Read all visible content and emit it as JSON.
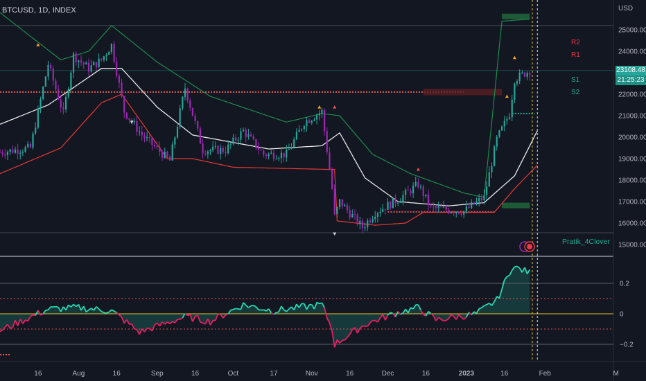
{
  "header": {
    "symbol": "BTCUSD, 1D, INDEX"
  },
  "price_axis": {
    "currency": "USD",
    "ticks": [
      25000,
      24000,
      23000,
      22000,
      21000,
      20000,
      19000,
      18000,
      17000,
      16000,
      15000
    ],
    "tick_labels": [
      "25000.00",
      "24000.00",
      "23000.00",
      "22000.00",
      "21000.00",
      "20000.00",
      "19000.00",
      "18000.00",
      "17000.00",
      "16000.00",
      "15000.00"
    ],
    "last_price": "23108.48",
    "countdown": "21:25:23"
  },
  "osc_axis": {
    "ticks": [
      0.2,
      0,
      -0.2
    ],
    "tick_labels": [
      "0.2",
      "0",
      "−0.2"
    ]
  },
  "time_axis": {
    "labels": [
      "16",
      "Aug",
      "16",
      "Sep",
      "16",
      "Oct",
      "17",
      "Nov",
      "16",
      "Dec",
      "16",
      "2023",
      "16",
      "Feb",
      "M"
    ]
  },
  "pivots": {
    "r2": "R2",
    "r1": "R1",
    "s1": "S1",
    "s2": "S2"
  },
  "watermark": "Pratik_4Clover",
  "colors": {
    "background": "#131722",
    "candle_up": "#26a69a",
    "candle_down": "#9c27b0",
    "ma_white": "#e8e8e8",
    "band_upper": "#1f8a4c",
    "band_lower": "#e53935",
    "resistance_dotted": "#ef5350",
    "last_price_box": "#26a69a",
    "osc_up": "#26d9b4",
    "osc_down": "#e91e63",
    "zero_line": "#e6c229",
    "pivot_red": "#f23645",
    "pivot_green": "#22ab94"
  },
  "chart_data": {
    "type": "candlestick",
    "title": "BTCUSD, 1D, INDEX",
    "ylabel": "USD",
    "ylim": [
      14600,
      26100
    ],
    "x_range": [
      "2022-07-01",
      "2023-02-28"
    ],
    "close_anchors": [
      {
        "date": "2022-07-01",
        "close": 19300
      },
      {
        "date": "2022-07-13",
        "close": 19500
      },
      {
        "date": "2022-07-20",
        "close": 23400
      },
      {
        "date": "2022-07-26",
        "close": 21100
      },
      {
        "date": "2022-07-30",
        "close": 23800
      },
      {
        "date": "2022-08-05",
        "close": 23200
      },
      {
        "date": "2022-08-10",
        "close": 23600
      },
      {
        "date": "2022-08-14",
        "close": 24300
      },
      {
        "date": "2022-08-19",
        "close": 21200
      },
      {
        "date": "2022-08-26",
        "close": 20100
      },
      {
        "date": "2022-09-06",
        "close": 18900
      },
      {
        "date": "2022-09-12",
        "close": 22300
      },
      {
        "date": "2022-09-19",
        "close": 19400
      },
      {
        "date": "2022-09-28",
        "close": 19400
      },
      {
        "date": "2022-10-05",
        "close": 20300
      },
      {
        "date": "2022-10-13",
        "close": 19200
      },
      {
        "date": "2022-10-22",
        "close": 19200
      },
      {
        "date": "2022-10-29",
        "close": 20700
      },
      {
        "date": "2022-11-05",
        "close": 21200
      },
      {
        "date": "2022-11-09",
        "close": 17600
      },
      {
        "date": "2022-11-10",
        "close": 16300
      },
      {
        "date": "2022-11-12",
        "close": 17000
      },
      {
        "date": "2022-11-21",
        "close": 15800
      },
      {
        "date": "2022-11-26",
        "close": 16500
      },
      {
        "date": "2022-12-05",
        "close": 17100
      },
      {
        "date": "2022-12-13",
        "close": 17800
      },
      {
        "date": "2022-12-18",
        "close": 16700
      },
      {
        "date": "2022-12-31",
        "close": 16550
      },
      {
        "date": "2023-01-08",
        "close": 17200
      },
      {
        "date": "2023-01-13",
        "close": 19900
      },
      {
        "date": "2023-01-18",
        "close": 21100
      },
      {
        "date": "2023-01-20",
        "close": 22700
      },
      {
        "date": "2023-01-26",
        "close": 23108
      }
    ],
    "ma_white_anchors": [
      {
        "date": "2022-07-01",
        "value": 20600
      },
      {
        "date": "2022-07-20",
        "value": 21500
      },
      {
        "date": "2022-08-10",
        "value": 23200
      },
      {
        "date": "2022-08-18",
        "value": 23200
      },
      {
        "date": "2022-09-01",
        "value": 21400
      },
      {
        "date": "2022-09-15",
        "value": 20100
      },
      {
        "date": "2022-10-15",
        "value": 19450
      },
      {
        "date": "2022-11-05",
        "value": 19600
      },
      {
        "date": "2022-11-12",
        "value": 20200
      },
      {
        "date": "2022-11-22",
        "value": 18100
      },
      {
        "date": "2022-12-05",
        "value": 17000
      },
      {
        "date": "2022-12-25",
        "value": 16800
      },
      {
        "date": "2023-01-08",
        "value": 16950
      },
      {
        "date": "2023-01-20",
        "value": 18200
      },
      {
        "date": "2023-01-29",
        "value": 20300
      }
    ],
    "band_upper_anchors": [
      {
        "date": "2022-07-01",
        "value": 25800
      },
      {
        "date": "2022-07-25",
        "value": 23600
      },
      {
        "date": "2022-08-05",
        "value": 24000
      },
      {
        "date": "2022-08-14",
        "value": 25200
      },
      {
        "date": "2022-09-01",
        "value": 23500
      },
      {
        "date": "2022-09-22",
        "value": 21900
      },
      {
        "date": "2022-10-22",
        "value": 20700
      },
      {
        "date": "2022-11-05",
        "value": 21100
      },
      {
        "date": "2022-11-12",
        "value": 21000
      },
      {
        "date": "2022-11-25",
        "value": 19200
      },
      {
        "date": "2022-12-10",
        "value": 18300
      },
      {
        "date": "2022-12-31",
        "value": 17400
      },
      {
        "date": "2023-01-08",
        "value": 17200
      },
      {
        "date": "2023-01-15",
        "value": 25400
      },
      {
        "date": "2023-01-26",
        "value": 25500
      }
    ],
    "band_lower_anchors": [
      {
        "date": "2022-07-01",
        "value": 18300
      },
      {
        "date": "2022-07-25",
        "value": 19500
      },
      {
        "date": "2022-08-10",
        "value": 21600
      },
      {
        "date": "2022-08-18",
        "value": 22000
      },
      {
        "date": "2022-09-05",
        "value": 19000
      },
      {
        "date": "2022-09-15",
        "value": 19000
      },
      {
        "date": "2022-10-01",
        "value": 18600
      },
      {
        "date": "2022-11-07",
        "value": 18500
      },
      {
        "date": "2022-11-10",
        "value": 18500
      },
      {
        "date": "2022-11-11",
        "value": 16100
      },
      {
        "date": "2022-11-26",
        "value": 15900
      },
      {
        "date": "2022-12-08",
        "value": 16000
      },
      {
        "date": "2022-12-15",
        "value": 16500
      },
      {
        "date": "2023-01-12",
        "value": 16500
      },
      {
        "date": "2023-01-20",
        "value": 17600
      },
      {
        "date": "2023-01-29",
        "value": 18700
      }
    ],
    "resistance_level": 22100,
    "osc_ylim": [
      -0.35,
      0.35
    ],
    "oscillator_anchors": [
      {
        "date": "2022-07-01",
        "value": -0.11
      },
      {
        "date": "2022-07-20",
        "value": 0.03
      },
      {
        "date": "2022-08-01",
        "value": 0.04
      },
      {
        "date": "2022-08-14",
        "value": 0.02
      },
      {
        "date": "2022-08-25",
        "value": -0.12
      },
      {
        "date": "2022-09-12",
        "value": -0.02
      },
      {
        "date": "2022-09-22",
        "value": -0.05
      },
      {
        "date": "2022-10-05",
        "value": 0.06
      },
      {
        "date": "2022-10-17",
        "value": 0.02
      },
      {
        "date": "2022-11-05",
        "value": 0.06
      },
      {
        "date": "2022-11-09",
        "value": -0.1
      },
      {
        "date": "2022-11-10",
        "value": -0.2
      },
      {
        "date": "2022-11-22",
        "value": -0.07
      },
      {
        "date": "2022-12-05",
        "value": 0.01
      },
      {
        "date": "2022-12-13",
        "value": 0.04
      },
      {
        "date": "2022-12-20",
        "value": -0.04
      },
      {
        "date": "2023-01-05",
        "value": 0.0
      },
      {
        "date": "2023-01-13",
        "value": 0.09
      },
      {
        "date": "2023-01-19",
        "value": 0.31
      },
      {
        "date": "2023-01-26",
        "value": 0.27
      }
    ]
  }
}
